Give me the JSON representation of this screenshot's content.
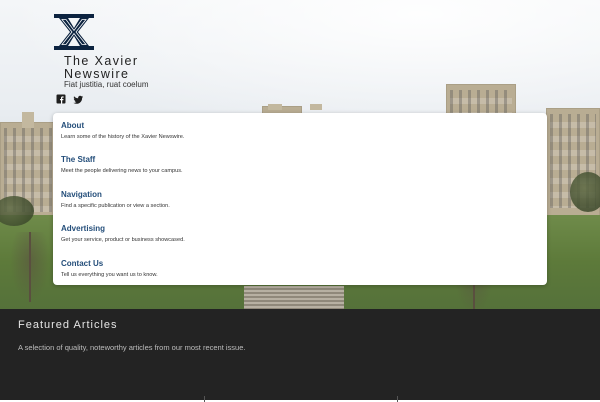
{
  "brand": {
    "title": "The Xavier Newswire",
    "tagline": "Fiat justitia, ruat coelum",
    "logo_icon": "xavier-x-logo",
    "social_icons": [
      "facebook-icon",
      "twitter-icon"
    ]
  },
  "menu": [
    {
      "label": "About",
      "description": "Learn some of the history of the Xavier Newswire."
    },
    {
      "label": "The Staff",
      "description": "Meet the people delivering news to your campus."
    },
    {
      "label": "Navigation",
      "description": "Find a specific publication or view a section."
    },
    {
      "label": "Advertising",
      "description": "Get your service, product or business showcased."
    },
    {
      "label": "Contact Us",
      "description": "Tell us everything you want us to know."
    }
  ],
  "featured": {
    "title": "Featured Articles",
    "description": "A selection of quality, noteworthy articles from our most recent issue."
  },
  "colors": {
    "link": "#244e7a",
    "logo_navy": "#0c2340",
    "footer_bg": "#232323"
  }
}
